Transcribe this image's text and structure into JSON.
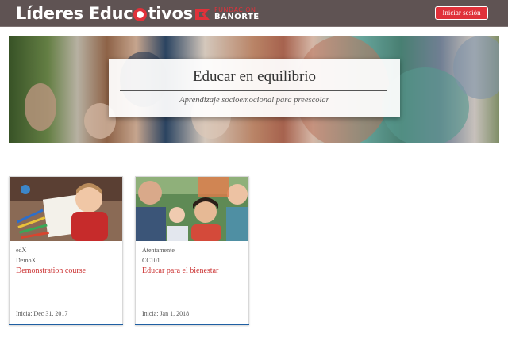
{
  "header": {
    "logo_part1": "Líderes Educ",
    "logo_part2": "tivos",
    "partner_line1": "FUNDACIÓN",
    "partner_line2": "BANORTE",
    "signin_label": "Iniciar sesión",
    "colors": {
      "bar": "#5f5353",
      "accent": "#e0313a"
    }
  },
  "hero": {
    "title": "Educar en equilibrio",
    "subtitle": "Aprendizaje socioemocional para preescolar"
  },
  "courses": [
    {
      "org": "edX",
      "code": "DemoX",
      "name": "Demonstration course",
      "start": "Inicia: Dec 31, 2017"
    },
    {
      "org": "Atentamente",
      "code": "CC101",
      "name": "Educar para el bienestar",
      "start": "Inicia: Jan 1, 2018"
    }
  ]
}
